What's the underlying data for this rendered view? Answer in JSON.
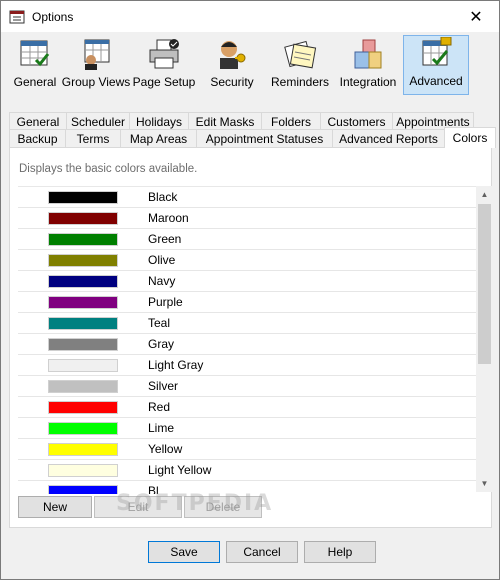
{
  "window": {
    "title": "Options",
    "close_glyph": "✕"
  },
  "toolbar": {
    "items": [
      {
        "label": "General",
        "icon": "calendar-check-icon"
      },
      {
        "label": "Group Views",
        "icon": "group-calendar-icon"
      },
      {
        "label": "Page Setup",
        "icon": "printer-icon"
      },
      {
        "label": "Security",
        "icon": "user-key-icon"
      },
      {
        "label": "Reminders",
        "icon": "reminder-notes-icon"
      },
      {
        "label": "Integration",
        "icon": "integration-blocks-icon"
      },
      {
        "label": "Advanced",
        "icon": "advanced-calendar-icon"
      }
    ],
    "selected": "Advanced"
  },
  "tabs": {
    "row1": [
      "General",
      "Scheduler",
      "Holidays",
      "Edit Masks",
      "Folders",
      "Customers",
      "Appointments"
    ],
    "row2": [
      "Backup",
      "Terms",
      "Map Areas",
      "Appointment Statuses",
      "Advanced Reports",
      "Colors"
    ],
    "selected": "Colors"
  },
  "colors_tab": {
    "description": "Displays the basic colors available.",
    "colors": [
      {
        "name": "Black",
        "hex": "#000000"
      },
      {
        "name": "Maroon",
        "hex": "#800000"
      },
      {
        "name": "Green",
        "hex": "#008000"
      },
      {
        "name": "Olive",
        "hex": "#808000"
      },
      {
        "name": "Navy",
        "hex": "#000080"
      },
      {
        "name": "Purple",
        "hex": "#800080"
      },
      {
        "name": "Teal",
        "hex": "#008080"
      },
      {
        "name": "Gray",
        "hex": "#808080"
      },
      {
        "name": "Light Gray",
        "hex": "#f0f0f0"
      },
      {
        "name": "Silver",
        "hex": "#c0c0c0"
      },
      {
        "name": "Red",
        "hex": "#ff0000"
      },
      {
        "name": "Lime",
        "hex": "#00ff00"
      },
      {
        "name": "Yellow",
        "hex": "#ffff00"
      },
      {
        "name": "Light Yellow",
        "hex": "#ffffe0"
      },
      {
        "name": "Bl",
        "hex": "#0000ff"
      }
    ],
    "new_label": "New",
    "edit_label": "Edit",
    "delete_label": "Delete"
  },
  "footer": {
    "save_label": "Save",
    "cancel_label": "Cancel",
    "help_label": "Help"
  },
  "watermark": "SOFTPEDIA"
}
